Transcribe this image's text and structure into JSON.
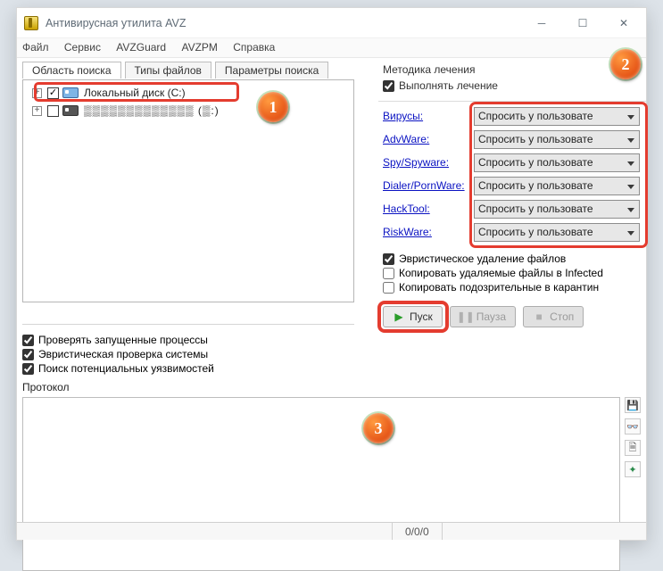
{
  "window": {
    "title": "Антивирусная утилита AVZ"
  },
  "menubar": {
    "items": [
      "Файл",
      "Сервис",
      "AVZGuard",
      "AVZPM",
      "Справка"
    ]
  },
  "tabs": [
    "Область поиска",
    "Типы файлов",
    "Параметры поиска"
  ],
  "tree": {
    "drive_c": "Локальный диск (C:)",
    "drive_d_obscured": "▒▒▒▒▒▒▒▒▒▒▒▒▒ (▒:)"
  },
  "left_checks": {
    "processes": "Проверять запущенные процессы",
    "heur_system": "Эвристическая проверка системы",
    "vuln": "Поиск потенциальных уязвимостей"
  },
  "protocol_label": "Протокол",
  "right": {
    "title": "Методика лечения",
    "perform": "Выполнять лечение",
    "threats": [
      "Вирусы:",
      "AdvWare:",
      "Spy/Spyware:",
      "Dialer/PornWare:",
      "HackTool:",
      "RiskWare:"
    ],
    "dd_value": "Спросить у пользовате",
    "heur_del": "Эвристическое удаление файлов",
    "copy_infected": "Копировать удаляемые файлы в Infected",
    "copy_quarantine": "Копировать подозрительные в карантин"
  },
  "buttons": {
    "start": "Пуск",
    "pause": "Пауза",
    "stop": "Стоп"
  },
  "status": {
    "counter": "0/0/0"
  },
  "markers": {
    "m1": "1",
    "m2": "2",
    "m3": "3"
  }
}
